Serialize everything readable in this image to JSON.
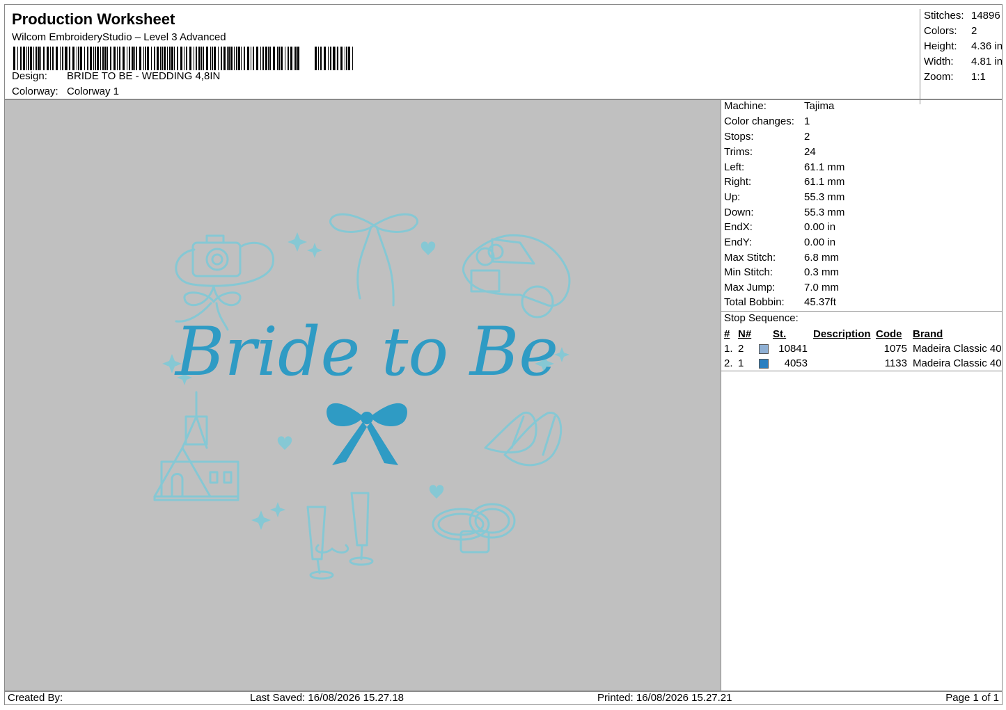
{
  "header": {
    "title": "Production Worksheet",
    "subtitle": "Wilcom EmbroideryStudio – Level 3 Advanced",
    "design_label": "Design:",
    "design_value": "BRIDE TO BE - WEDDING 4,8IN",
    "colorway_label": "Colorway:",
    "colorway_value": "Colorway 1"
  },
  "stats": [
    {
      "label": "Stitches:",
      "value": "14896"
    },
    {
      "label": "Colors:",
      "value": "2"
    },
    {
      "label": "Height:",
      "value": "4.36 in"
    },
    {
      "label": "Width:",
      "value": "4.81 in"
    },
    {
      "label": "Zoom:",
      "value": "1:1"
    }
  ],
  "machine_info": [
    {
      "label": "Machine:",
      "value": "Tajima"
    },
    {
      "label": "Color changes:",
      "value": "1"
    },
    {
      "label": "Stops:",
      "value": "2"
    },
    {
      "label": "Trims:",
      "value": "24"
    },
    {
      "label": "Left:",
      "value": "61.1 mm"
    },
    {
      "label": "Right:",
      "value": "61.1 mm"
    },
    {
      "label": "Up:",
      "value": "55.3 mm"
    },
    {
      "label": "Down:",
      "value": "55.3 mm"
    },
    {
      "label": "EndX:",
      "value": "0.00 in"
    },
    {
      "label": "EndY:",
      "value": "0.00 in"
    },
    {
      "label": "Max Stitch:",
      "value": "6.8 mm"
    },
    {
      "label": "Min Stitch:",
      "value": "0.3 mm"
    },
    {
      "label": "Max Jump:",
      "value": "7.0 mm"
    },
    {
      "label": "Total Bobbin:",
      "value": "45.37ft"
    }
  ],
  "stop_sequence": {
    "title": "Stop Sequence:",
    "columns": {
      "idx": "#",
      "n": "N#",
      "st": "St.",
      "desc": "Description",
      "code": "Code",
      "brand": "Brand"
    },
    "rows": [
      {
        "idx": "1.",
        "n": "2",
        "color": "#8fb0d4",
        "st": "10841",
        "desc": "",
        "code": "1075",
        "brand": "Madeira Classic 40"
      },
      {
        "idx": "2.",
        "n": "1",
        "color": "#2a7fc0",
        "st": "4053",
        "desc": "",
        "code": "1133",
        "brand": "Madeira Classic 40"
      }
    ]
  },
  "design": {
    "text": "Bride to Be",
    "light_thread": "#86c8d4",
    "dark_thread": "#2f9bc4",
    "background": "#c0c0c0"
  },
  "footer": {
    "created": "Created By:",
    "saved": "Last Saved: 16/08/2026 15.27.18",
    "printed": "Printed: 16/08/2026 15.27.21",
    "page": "Page 1 of 1"
  }
}
